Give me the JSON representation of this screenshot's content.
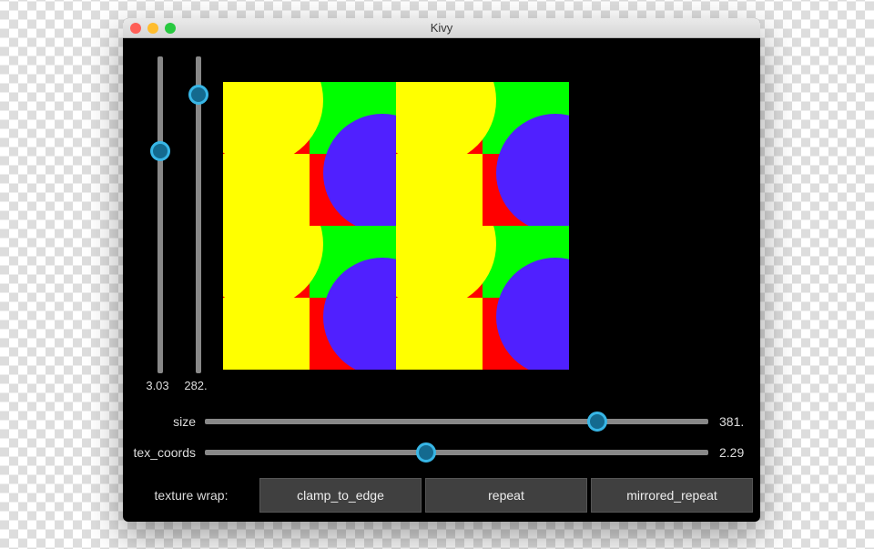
{
  "window": {
    "title": "Kivy"
  },
  "vertical_sliders": {
    "left": {
      "value": "3.03",
      "thumb_pct": 30
    },
    "right": {
      "value": "282.",
      "thumb_pct": 12
    }
  },
  "controls": {
    "size": {
      "label": "size",
      "value": "381.",
      "thumb_pct": 78
    },
    "tex_coords": {
      "label": "tex_coords",
      "value": "2.29",
      "thumb_pct": 44
    }
  },
  "texture_wrap": {
    "label": "texture wrap:",
    "options": [
      "clamp_to_edge",
      "repeat",
      "mirrored_repeat"
    ]
  }
}
